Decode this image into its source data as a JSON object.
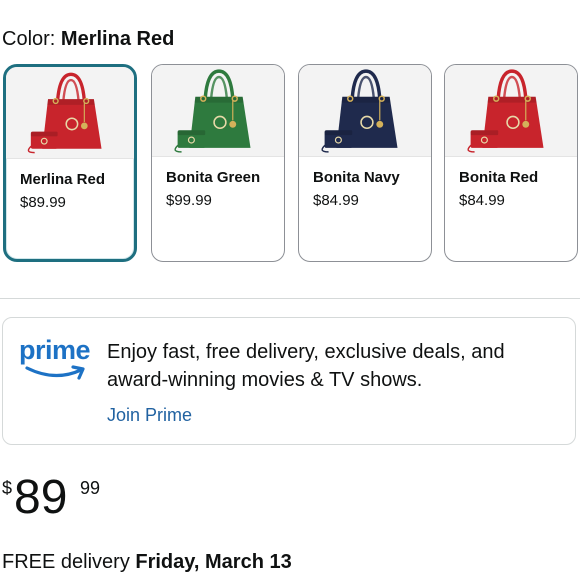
{
  "color_selector": {
    "label": "Color:",
    "selected": "Merlina Red"
  },
  "swatches": [
    {
      "name": "Merlina Red",
      "price": "$89.99",
      "selected": true,
      "bag_color": "#c8242c"
    },
    {
      "name": "Bonita Green",
      "price": "$99.99",
      "selected": false,
      "bag_color": "#2e7a3e"
    },
    {
      "name": "Bonita Navy",
      "price": "$84.99",
      "selected": false,
      "bag_color": "#1f2a4d"
    },
    {
      "name": "Bonita Red",
      "price": "$84.99",
      "selected": false,
      "bag_color": "#c8242c"
    }
  ],
  "prime": {
    "logo_text": "prime",
    "message": "Enjoy fast, free delivery, exclusive deals, and award-winning movies & TV shows.",
    "link": "Join Prime"
  },
  "price": {
    "symbol": "$",
    "whole": "89",
    "fraction": "99"
  },
  "delivery": {
    "prefix": "FREE delivery",
    "date": "Friday, March 13"
  },
  "colors": {
    "accent_teal": "#1e6f80",
    "prime_blue": "#1d72c5",
    "link_blue": "#2162a1"
  }
}
